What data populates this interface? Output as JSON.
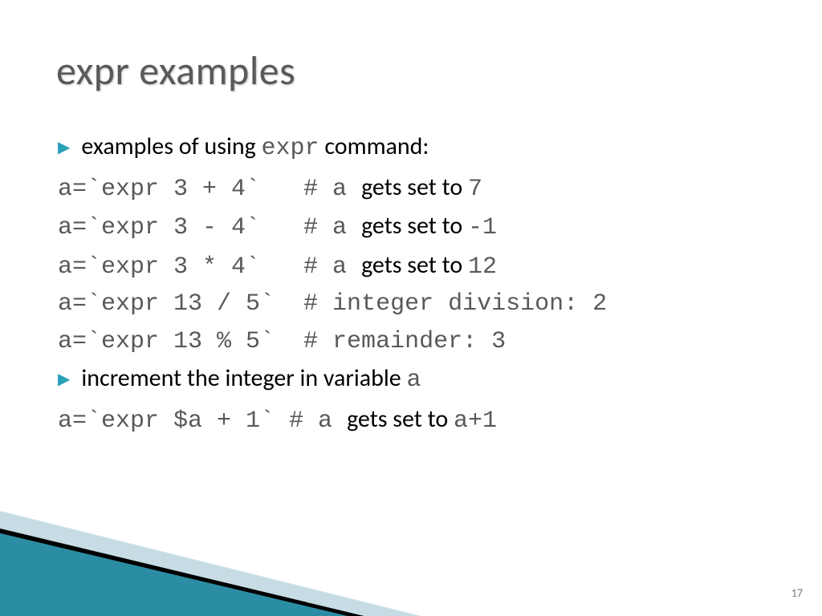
{
  "title": "expr examples",
  "bullets": {
    "b1_pre": "examples of using ",
    "b1_mono": "expr",
    "b1_post": " command:",
    "b2_pre": "increment the integer in variable ",
    "b2_mono": "a"
  },
  "lines": {
    "l1_code": "a=`expr 3 + 4`   # a ",
    "l1_plain": "gets set to ",
    "l1_tail": "7",
    "l2_code": "a=`expr 3 - 4`   # a ",
    "l2_plain": "gets set to ",
    "l2_tail": "-1",
    "l3_code": "a=`expr 3 * 4`   # a ",
    "l3_plain": "gets set to ",
    "l3_tail": "12",
    "l4_code": "a=`expr 13 / 5`  # integer division: 2",
    "l5_code": "a=`expr 13 % 5`  # remainder: 3",
    "l6_code": "a=`expr $a + 1` # a ",
    "l6_plain": "gets set to ",
    "l6_tail": "a+1"
  },
  "page": "17"
}
